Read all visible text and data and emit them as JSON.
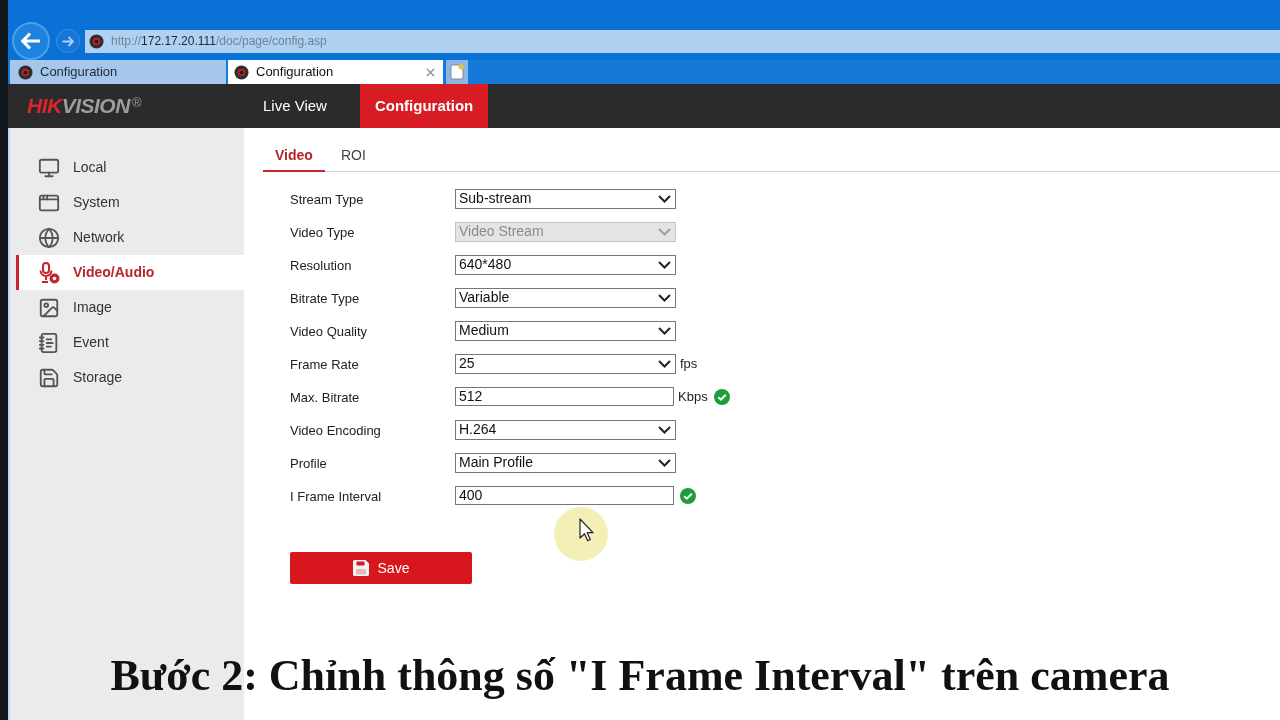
{
  "browser": {
    "url": {
      "scheme": "http://",
      "host": "172.17.20.111",
      "path": "/doc/page/config.asp"
    },
    "tabs": [
      {
        "title": "Configuration",
        "selected": false
      },
      {
        "title": "Configuration",
        "selected": true
      }
    ]
  },
  "header": {
    "logo": {
      "accent": "HIK",
      "rest": "VISION",
      "registered": "®"
    },
    "nav": [
      {
        "label": "Live View",
        "selected": false
      },
      {
        "label": "Configuration",
        "selected": true
      }
    ]
  },
  "sidebar": {
    "items": [
      {
        "label": "Local",
        "selected": false
      },
      {
        "label": "System",
        "selected": false
      },
      {
        "label": "Network",
        "selected": false
      },
      {
        "label": "Video/Audio",
        "selected": true
      },
      {
        "label": "Image",
        "selected": false
      },
      {
        "label": "Event",
        "selected": false
      },
      {
        "label": "Storage",
        "selected": false
      }
    ]
  },
  "content": {
    "tabs": [
      {
        "label": "Video",
        "selected": true
      },
      {
        "label": "ROI",
        "selected": false
      }
    ],
    "fields": [
      {
        "label": "Stream Type",
        "kind": "select",
        "value": "Sub-stream",
        "disabled": false
      },
      {
        "label": "Video Type",
        "kind": "select",
        "value": "Video Stream",
        "disabled": true
      },
      {
        "label": "Resolution",
        "kind": "select",
        "value": "640*480",
        "disabled": false
      },
      {
        "label": "Bitrate Type",
        "kind": "select",
        "value": "Variable",
        "disabled": false
      },
      {
        "label": "Video Quality",
        "kind": "select",
        "value": "Medium",
        "disabled": false
      },
      {
        "label": "Frame Rate",
        "kind": "select",
        "value": "25",
        "unit": "fps",
        "disabled": false
      },
      {
        "label": "Max. Bitrate",
        "kind": "input",
        "value": "512",
        "unit": "Kbps",
        "valid": true,
        "disabled": false
      },
      {
        "label": "Video Encoding",
        "kind": "select",
        "value": "H.264",
        "disabled": false
      },
      {
        "label": "Profile",
        "kind": "select",
        "value": "Main Profile",
        "disabled": false
      },
      {
        "label": "I Frame Interval",
        "kind": "input",
        "value": "400",
        "valid": true,
        "disabled": false
      }
    ],
    "save_button": {
      "label": "Save"
    }
  },
  "caption": "Bước 2: Chỉnh thông số \"I Frame Interval\" trên camera"
}
